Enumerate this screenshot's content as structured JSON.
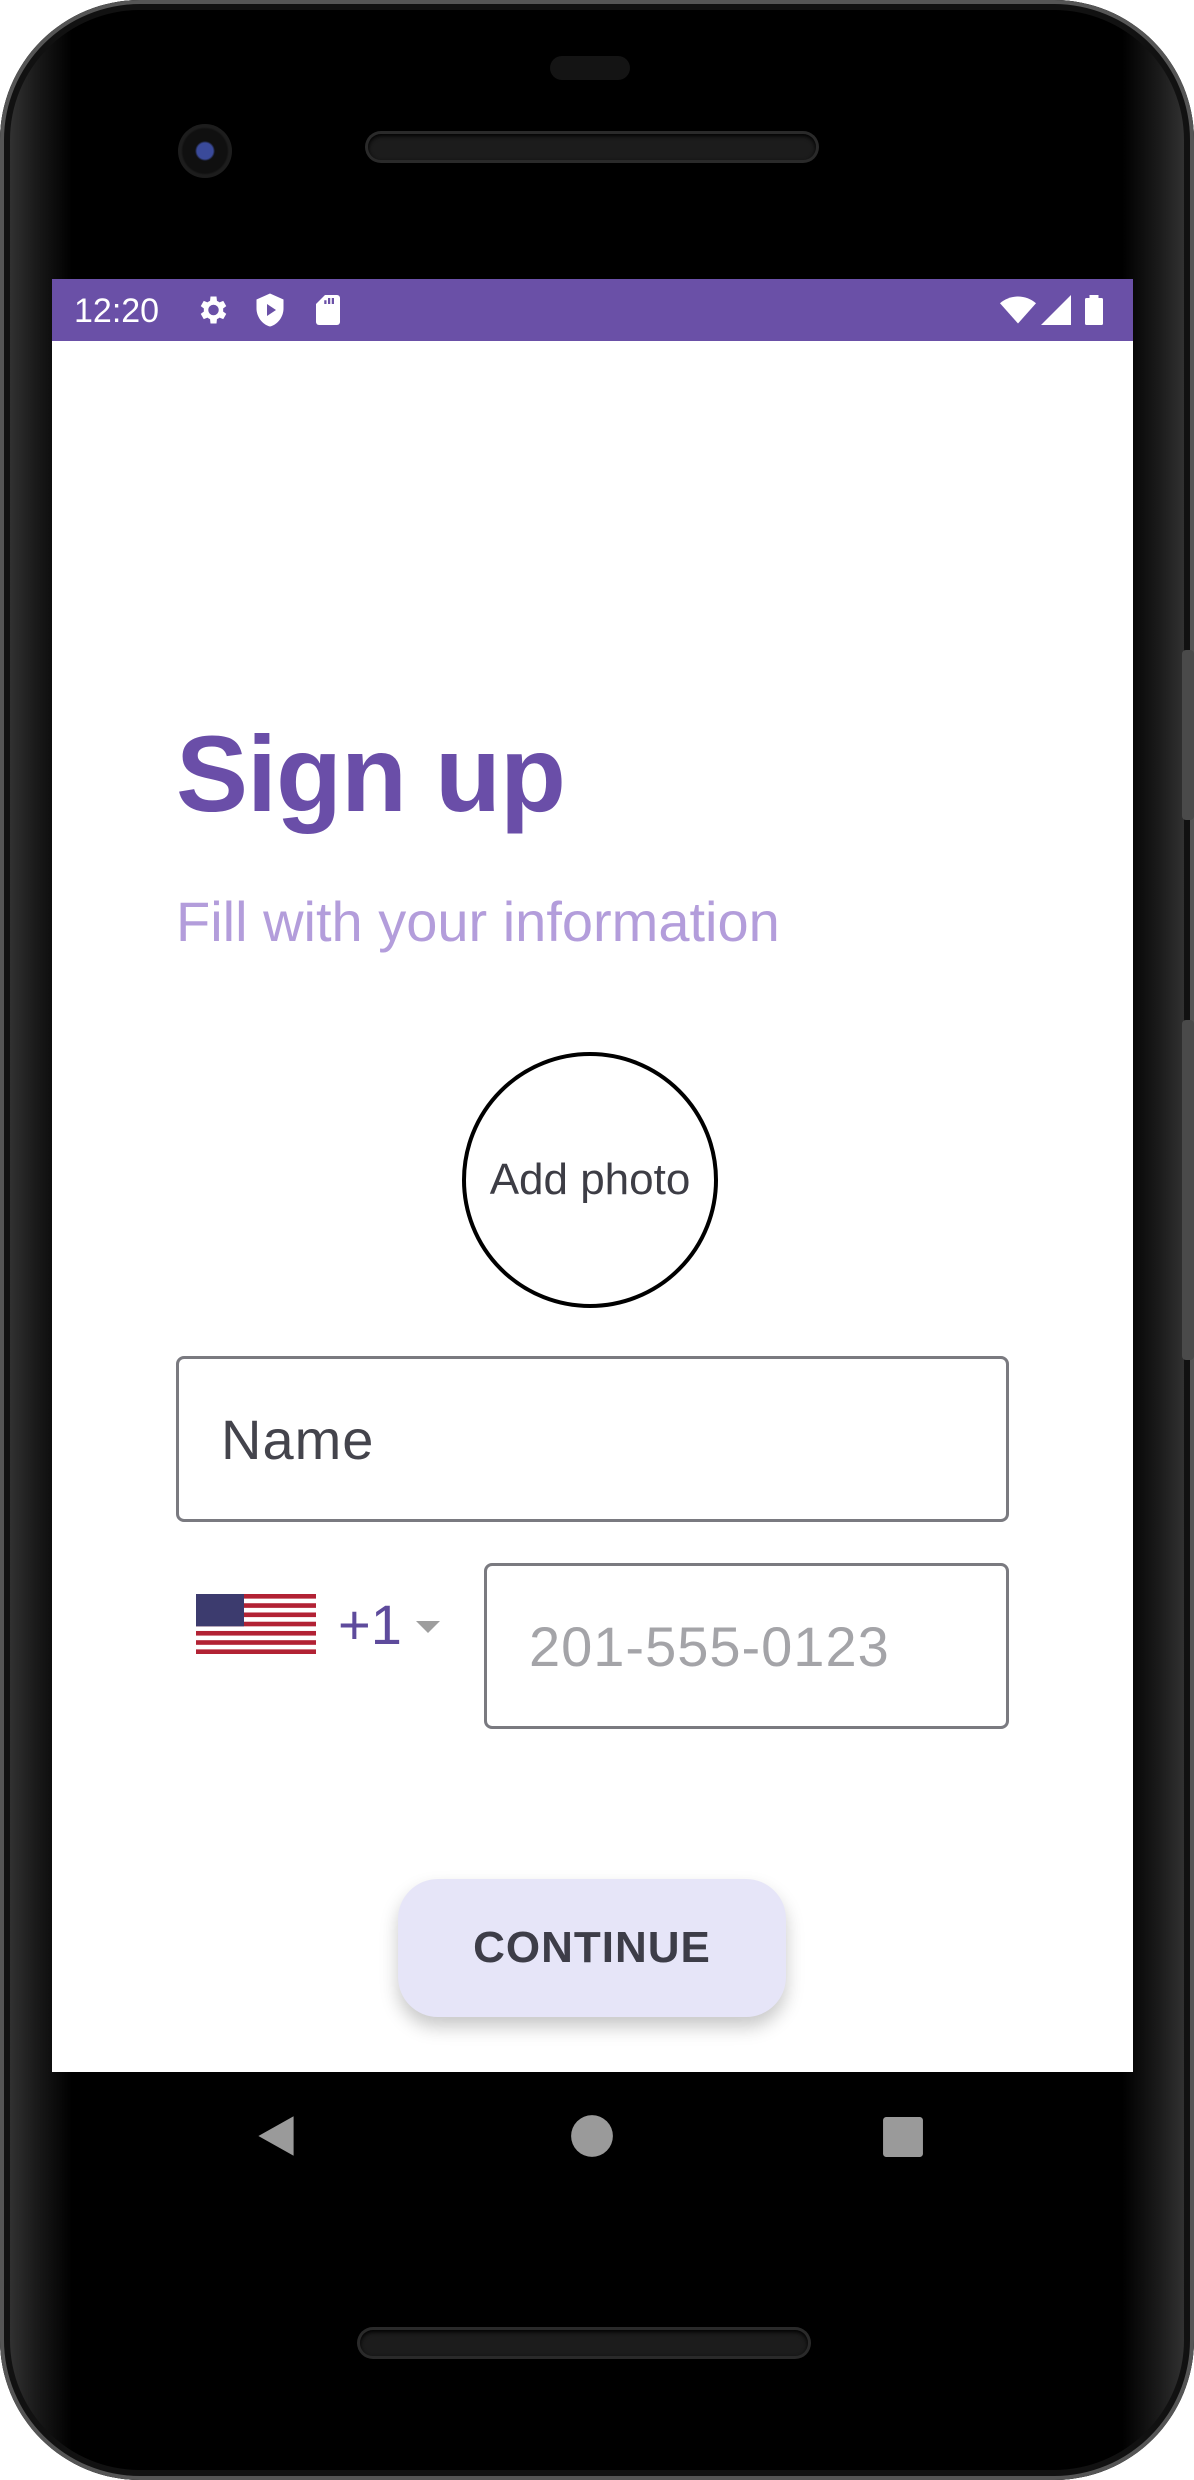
{
  "status_bar": {
    "time": "12:20",
    "background_color": "#6a50a7",
    "left_icons": [
      "gear-icon",
      "shield-play-icon",
      "sd-card-icon"
    ],
    "right_icons": [
      "wifi-icon",
      "signal-icon",
      "battery-icon"
    ]
  },
  "signup": {
    "title": "Sign up",
    "subtitle": "Fill with your information",
    "title_color": "#6a4ea8",
    "subtitle_color": "#b39ddb",
    "photo_label": "Add photo",
    "name_placeholder": "Name",
    "country_flag": "us-flag-icon",
    "country_code": "+1",
    "phone_placeholder": "201-555-0123",
    "continue_label": "CONTINUE"
  },
  "navigation_bar": {
    "buttons": [
      "back-triangle-icon",
      "home-circle-icon",
      "recents-square-icon"
    ]
  }
}
